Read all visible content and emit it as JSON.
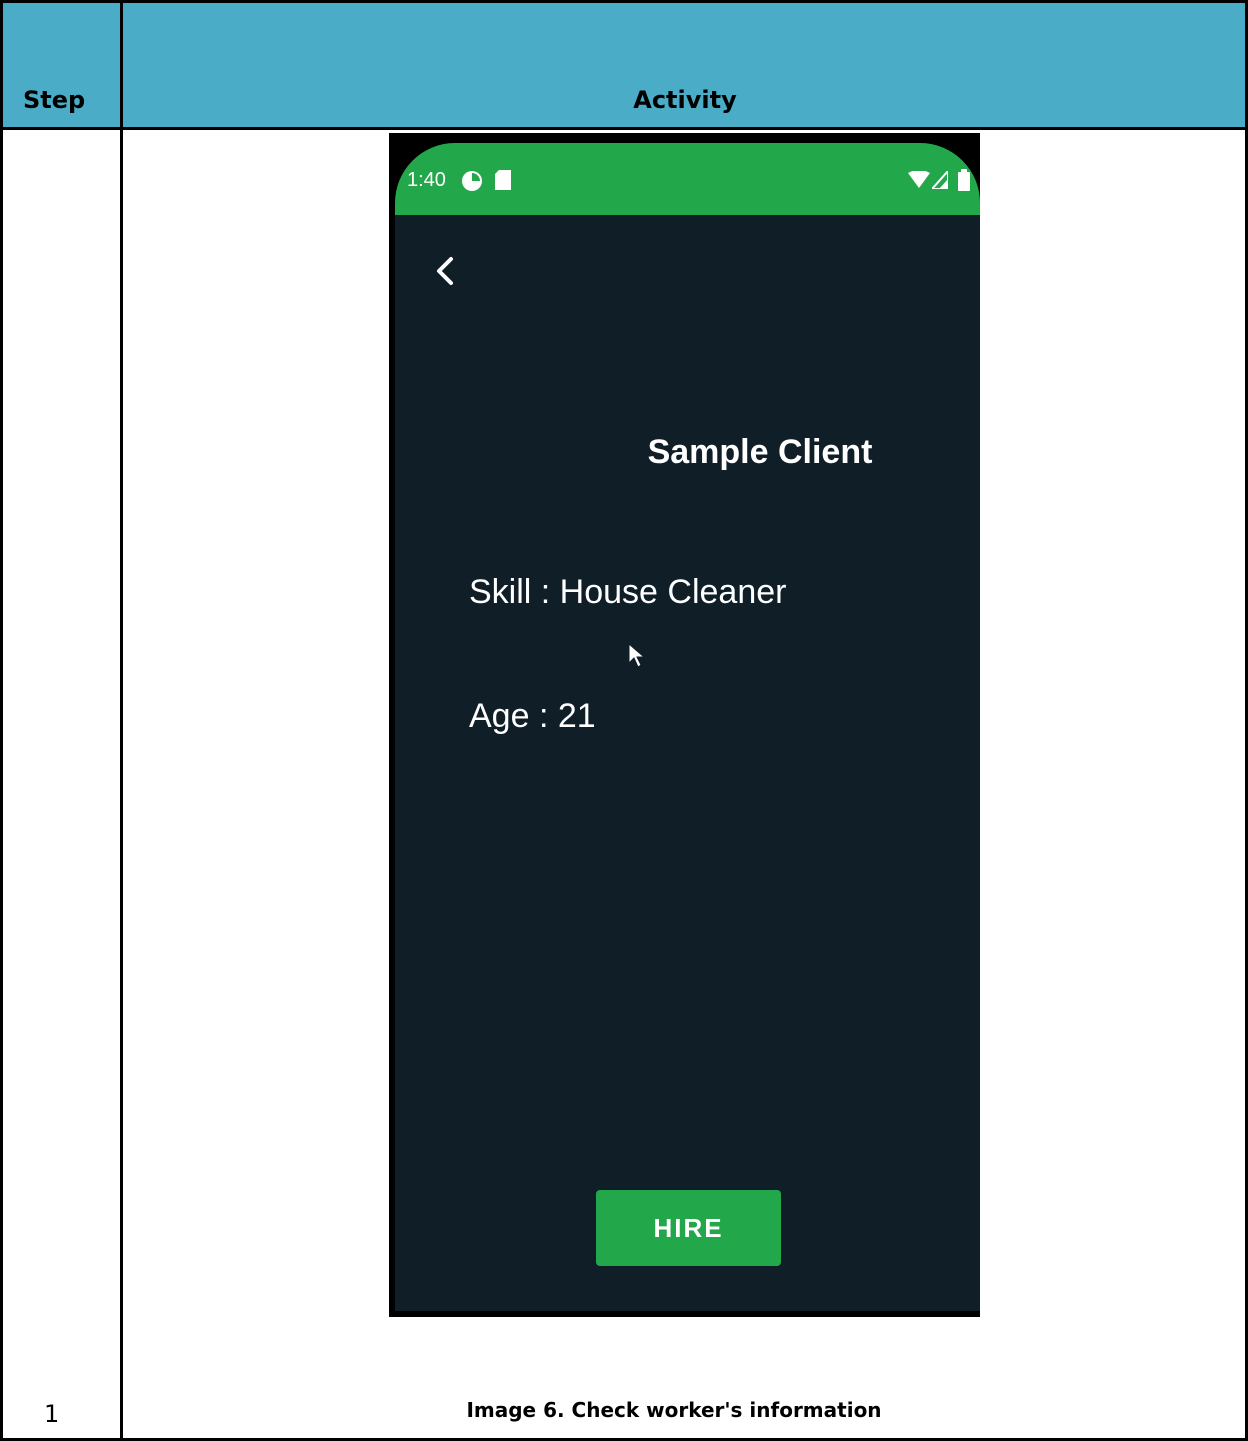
{
  "table": {
    "header_step": "Step",
    "header_activity": "Activity",
    "header_bg": "#4aacc6",
    "step_number": "1",
    "caption": "Image 6. Check worker's information"
  },
  "phone": {
    "status_time": "1:40",
    "status_bar_color": "#22a84a",
    "screen_bg": "#101e28",
    "client_name": "Sample Client",
    "skill_line": "Skill : House Cleaner",
    "age_line": "Age : 21",
    "hire_label": "HIRE",
    "icons": [
      "back-arrow-icon",
      "pie-icon",
      "sd-card-icon",
      "wifi-icon",
      "signal-icon",
      "battery-icon",
      "mouse-cursor-icon"
    ]
  }
}
